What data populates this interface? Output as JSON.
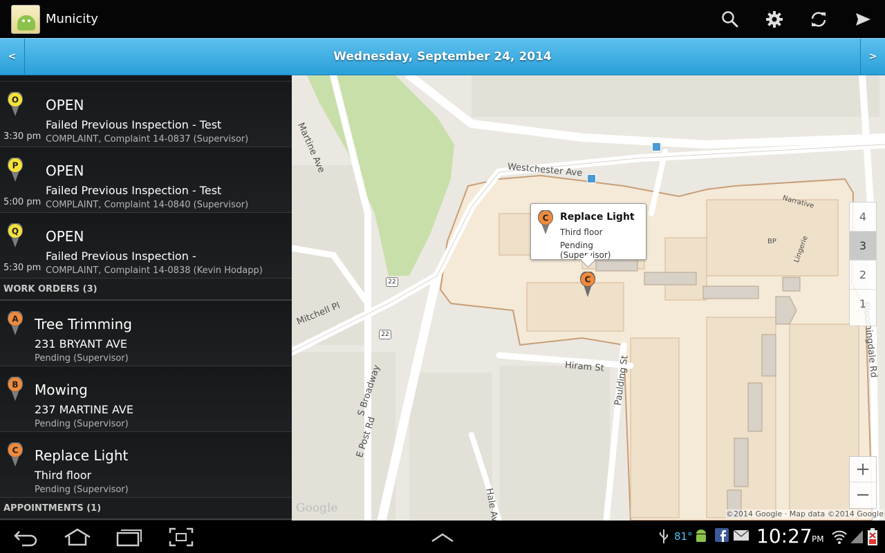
{
  "app": {
    "title": "Municity"
  },
  "actionbar": {
    "actions": [
      {
        "icon": "search-icon"
      },
      {
        "icon": "gear-icon"
      },
      {
        "icon": "refresh-icon"
      },
      {
        "icon": "send-icon"
      }
    ]
  },
  "datebar": {
    "prev": "<",
    "next": ">",
    "date": "Wednesday, September 24, 2014"
  },
  "list": {
    "inspections": [
      {
        "marker": "O",
        "time": "3:30 pm",
        "status": "OPEN",
        "title": "Failed Previous Inspection - Test",
        "detail": "COMPLAINT, Complaint 14-0837 (Supervisor)"
      },
      {
        "marker": "P",
        "time": "5:00 pm",
        "status": "OPEN",
        "title": "Failed Previous Inspection - Test",
        "detail": "COMPLAINT, Complaint 14-0840 (Supervisor)"
      },
      {
        "marker": "Q",
        "time": "5:30 pm",
        "status": "OPEN",
        "title": "Failed Previous Inspection -",
        "detail": "COMPLAINT, Complaint 14-0838 (Kevin Hodapp)"
      }
    ],
    "work_orders_header": "WORK ORDERS (3)",
    "work_orders": [
      {
        "marker": "A",
        "title": "Tree Trimming",
        "address": "231 BRYANT AVE",
        "status": "Pending (Supervisor)"
      },
      {
        "marker": "B",
        "title": "Mowing",
        "address": "237 MARTINE AVE",
        "status": "Pending (Supervisor)"
      },
      {
        "marker": "C",
        "title": "Replace Light",
        "address": "Third floor",
        "status": "Pending (Supervisor)"
      }
    ],
    "appointments_header": "APPOINTMENTS (1)"
  },
  "map": {
    "streets": {
      "martine": "Martine Ave",
      "westchester": "Westchester Ave",
      "mitchell": "Mitchell Pl",
      "broadway": "S Broadway",
      "epost": "E Post Rd",
      "hiram": "Hiram St",
      "paulding": "Paulding St",
      "hale": "Hale Ave",
      "bloomingdale": "Bloomingdale Rd",
      "narrative": "Narrative",
      "bp": "BP",
      "lingerie": "Lingerie"
    },
    "route_shield": "22",
    "route_shield2": "22",
    "levels": [
      "4",
      "3",
      "2",
      "1"
    ],
    "active_level": "3",
    "zoom_in": "+",
    "zoom_out": "−",
    "google_logo": "Google",
    "attribution": "©2014 Google · Map data ©2014 Google",
    "infowindow": {
      "marker": "C",
      "title": "Replace Light",
      "line2": "Third floor",
      "line3": "Pending (Supervisor)"
    },
    "selected_marker": "C"
  },
  "colors": {
    "marker_yellow": "#f4e23a",
    "marker_orange": "#f08a3a",
    "accent_blue": "#2a9fd8"
  },
  "sysbar": {
    "temperature": "81°",
    "time": "10:27",
    "ampm": "PM"
  }
}
